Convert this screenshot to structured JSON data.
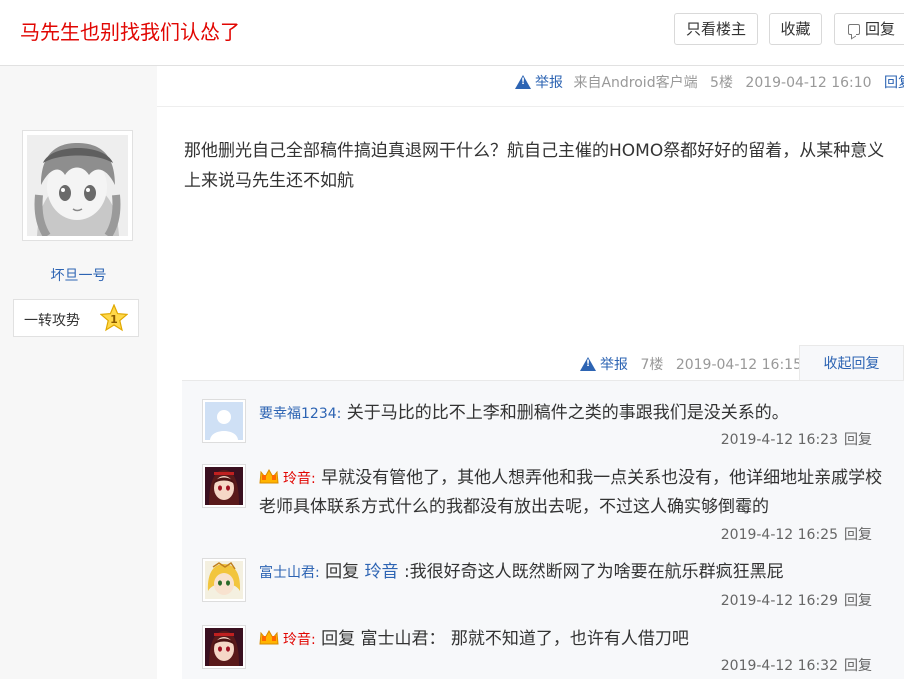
{
  "header": {
    "title": "马先生也别找我们认怂了",
    "only_lz_label": "只看楼主",
    "favorite_label": "收藏",
    "reply_label": "回复"
  },
  "floor5": {
    "report_label": "举报",
    "source": "来自Android客户端",
    "floor": "5楼",
    "time": "2019-04-12 16:10",
    "reply_label": "回复"
  },
  "author": {
    "name": "坏旦一号",
    "badge_text": "一转攻势",
    "badge_level": "1"
  },
  "post": {
    "content": "那他删光自己全部稿件搞迫真退网干什么？航自己主催的HOMO祭都好好的留着，从某种意义上来说马先生还不如航",
    "report_label": "举报",
    "floor": "7楼",
    "time": "2019-04-12 16:15",
    "collapse_label": "收起回复"
  },
  "comments": [
    {
      "user": "要幸福1234:",
      "text": "关于马比的比不上李和删稿件之类的事跟我们是没关系的。",
      "time": "2019-4-12 16:23",
      "reply_label": "回复"
    },
    {
      "user": "玲音:",
      "text": "早就没有管他了，其他人想弄他和我一点关系也没有，他详细地址亲戚学校老师具体联系方式什么的我都没有放出去呢，不过这人确实够倒霉的",
      "time": "2019-4-12 16:25",
      "reply_label": "回复"
    },
    {
      "user": "富士山君:",
      "reply_word": "回复",
      "reply_to": "玲音",
      "text": ":我很好奇这人既然断网了为啥要在航乐群疯狂黑屁",
      "time": "2019-4-12 16:29",
      "reply_label": "回复"
    },
    {
      "user": "玲音:",
      "reply_word": "回复",
      "reply_to": "富士山君",
      "text": "： 那就不知道了，也许有人借刀吧",
      "time": "2019-4-12 16:32",
      "reply_label": "回复"
    }
  ]
}
